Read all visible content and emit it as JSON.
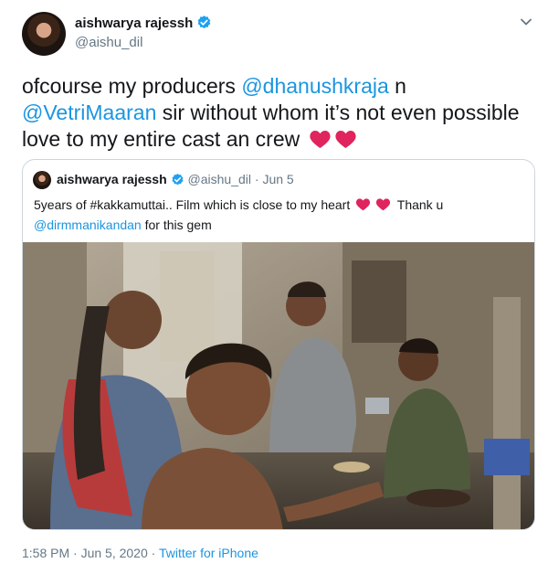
{
  "author": {
    "name": "aishwarya rajessh",
    "handle": "@aishu_dil"
  },
  "tweet": {
    "text_1": "ofcourse my producers ",
    "mention_1": "@dhanushkraja",
    "text_2": " n ",
    "mention_2": "@VetriMaaran",
    "text_3": " sir without whom it’s not even possible love to my entire cast an crew"
  },
  "quoted": {
    "name": "aishwarya rajessh",
    "handle": "@aishu_dil",
    "separator": " · ",
    "date": "Jun 5",
    "text_1": "5years of #kakkamuttai.. Film which is close to my heart",
    "text_2": " Thank u ",
    "mention": "@dirmmanikandan",
    "text_3": " for this gem"
  },
  "footer": {
    "timestamp": "1:58 PM · Jun 5, 2020 · ",
    "source": "Twitter for iPhone"
  },
  "colors": {
    "link": "#1b95e0",
    "verified": "#1da1f2",
    "heart": "#e0245e",
    "secondary_text": "#657786",
    "border": "#ccd6dd"
  },
  "icons": [
    "verified-badge-icon",
    "chevron-down-icon",
    "heart-icon"
  ]
}
